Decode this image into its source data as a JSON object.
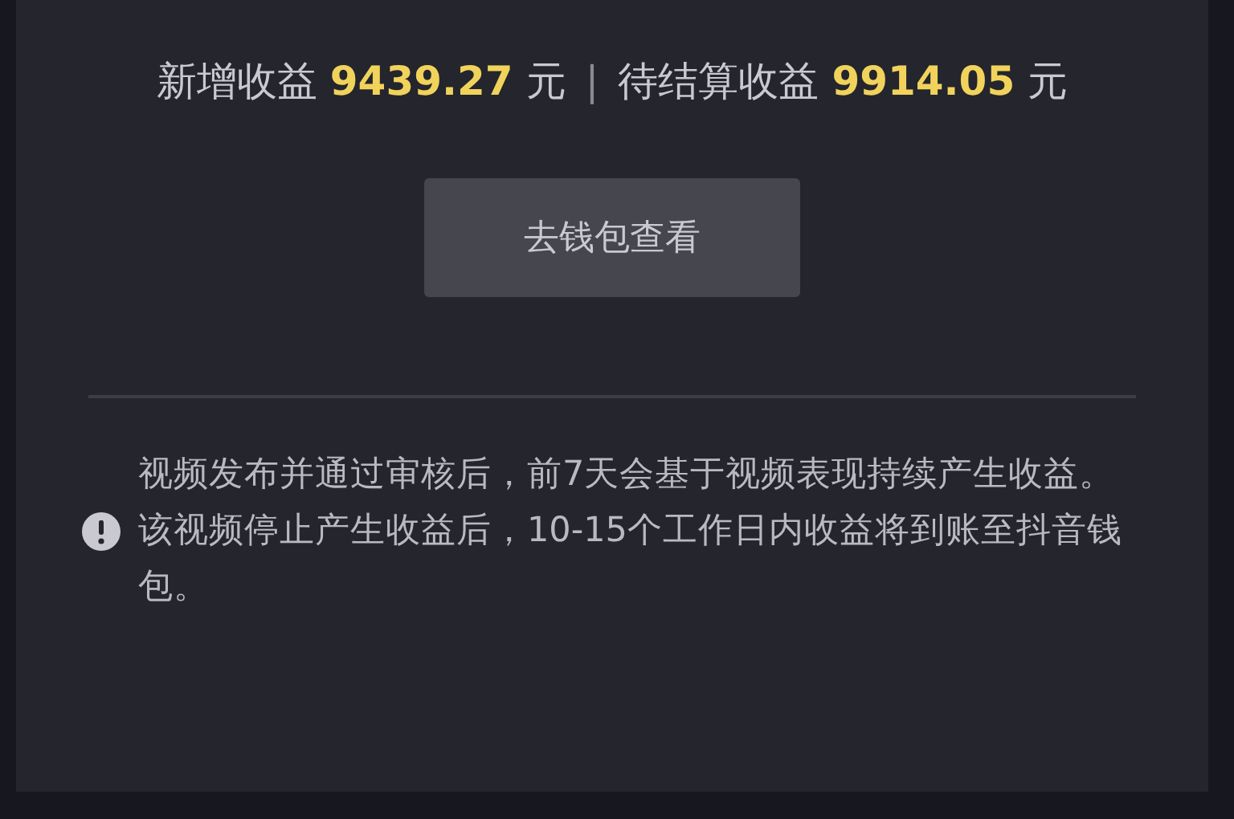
{
  "summary": {
    "items": [
      {
        "label": "新增收益",
        "amount": "9439.27",
        "unit": "元"
      },
      {
        "label": "待结算收益",
        "amount": "9914.05",
        "unit": "元"
      }
    ],
    "separator": "|"
  },
  "wallet_button": {
    "label": "去钱包查看"
  },
  "notice": {
    "paragraphs": [
      "视频发布并通过审核后，前7天会基于视频表现持续产生收益。",
      "该视频停止产生收益后，10-15个工作日内收益将到账至抖音钱包。"
    ]
  }
}
